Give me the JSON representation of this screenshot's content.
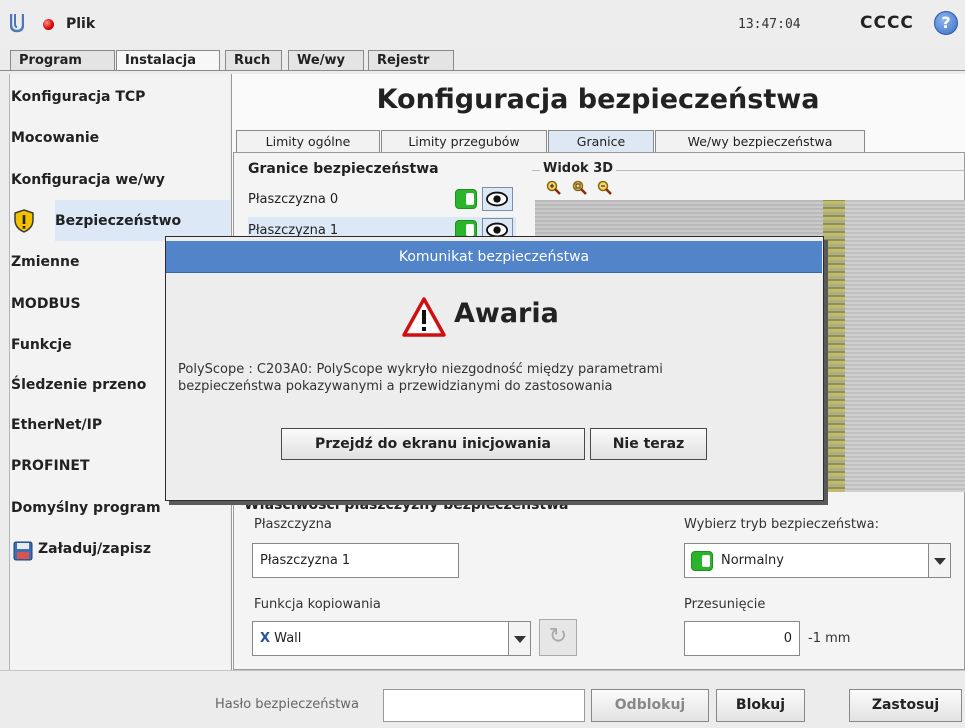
{
  "app": {
    "name": "Plik",
    "clock": "13:47:04",
    "robot_name": "CCCC",
    "help_symbol": "?"
  },
  "main_tabs": [
    {
      "label": "Program",
      "active": false
    },
    {
      "label": "Instalacja",
      "active": true
    },
    {
      "label": "Ruch",
      "active": false
    },
    {
      "label": "We/wy",
      "active": false
    },
    {
      "label": "Rejestr",
      "active": false
    }
  ],
  "sidebar": {
    "items": [
      {
        "label": "Konfiguracja TCP"
      },
      {
        "label": "Mocowanie"
      },
      {
        "label": "Konfiguracja we/wy"
      },
      {
        "label": "Bezpieczeństwo",
        "selected": true,
        "icon": "shield-warning-icon"
      },
      {
        "label": "Zmienne"
      },
      {
        "label": "MODBUS"
      },
      {
        "label": "Funkcje"
      },
      {
        "label": "Śledzenie przeno"
      },
      {
        "label": "EtherNet/IP"
      },
      {
        "label": "PROFINET"
      },
      {
        "label": "Domyślny program"
      },
      {
        "label": "Załaduj/zapisz",
        "icon": "floppy-disk-icon"
      }
    ]
  },
  "content": {
    "title": "Konfiguracja bezpieczeństwa",
    "sub_tabs": [
      {
        "label": "Limity ogólne",
        "active": false
      },
      {
        "label": "Limity przegubów",
        "active": false
      },
      {
        "label": "Granice",
        "active": true
      },
      {
        "label": "We/wy bezpieczeństwa",
        "active": false
      }
    ],
    "bounds": {
      "title": "Granice bezpieczeństwa",
      "planes": [
        {
          "label": "Płaszczyzna 0",
          "enabled": true,
          "visible": true
        },
        {
          "label": "Płaszczyzna 1",
          "enabled": true,
          "visible": true,
          "selected": true
        }
      ]
    },
    "view3d": {
      "title": "Widok 3D",
      "zoom_icons": [
        "zoom-in-icon",
        "zoom-reset-icon",
        "zoom-out-icon"
      ]
    },
    "properties": {
      "title": "Właściwości płaszczyzny bezpieczeństwa",
      "plane_label": "Płaszczyzna",
      "plane_value": "Płaszczyzna 1",
      "copy_label": "Funkcja kopiowania",
      "copy_value": "Wall",
      "copy_prefix": "X",
      "mode_label": "Wybierz tryb bezpieczeństwa:",
      "mode_value": "Normalny",
      "offset_label": "Przesunięcie",
      "offset_value": "0",
      "offset_unit": "-1 mm"
    }
  },
  "bottom": {
    "password_label": "Hasło bezpieczeństwa",
    "password_value": "",
    "unlock_label": "Odblokuj",
    "lock_label": "Blokuj",
    "apply_label": "Zastosuj"
  },
  "dialog": {
    "title": "Komunikat bezpieczeństwa",
    "heading": "Awaria",
    "message_line1": "PolyScope : C203A0: PolyScope wykryło niezgodność między parametrami",
    "message_line2": "bezpieczeństwa pokazywanymi a przewidzianymi do zastosowania",
    "primary_button": "Przejdź do ekranu inicjowania",
    "secondary_button": "Nie teraz"
  },
  "colors": {
    "dialog_title_bar": "#5284ca",
    "selection": "#dce8f6",
    "toggle_on": "#2bb32b",
    "status_dot": "#d60000"
  }
}
